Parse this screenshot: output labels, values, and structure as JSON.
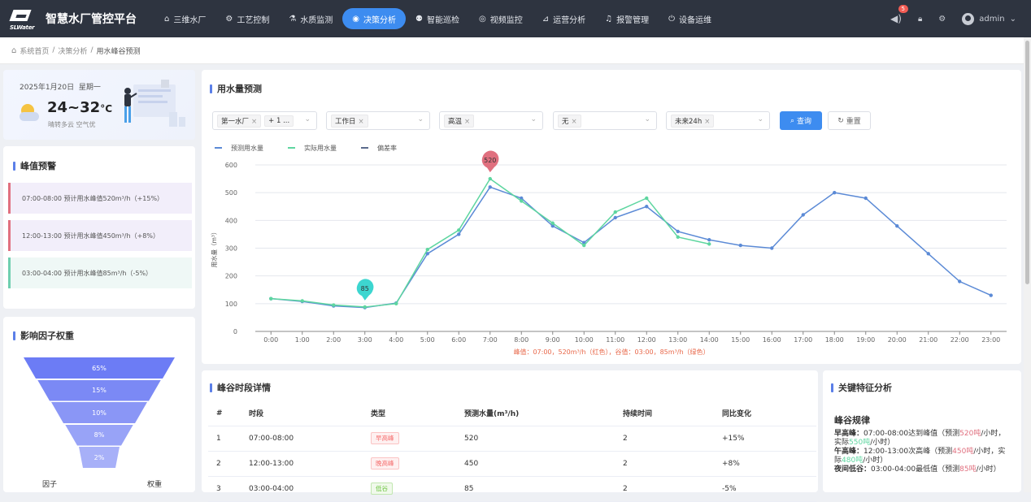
{
  "app": {
    "logo_text": "SLWater",
    "title": "智慧水厂管控平台"
  },
  "nav": [
    {
      "icon": "⌂",
      "label": "三维水厂",
      "active": false
    },
    {
      "icon": "⚙",
      "label": "工艺控制",
      "active": false
    },
    {
      "icon": "⚗",
      "label": "水质监测",
      "active": false
    },
    {
      "icon": "◉",
      "label": "决策分析",
      "active": true
    },
    {
      "icon": "⚉",
      "label": "智能巡检",
      "active": false
    },
    {
      "icon": "◎",
      "label": "视频监控",
      "active": false
    },
    {
      "icon": "⊿",
      "label": "运营分析",
      "active": false
    },
    {
      "icon": "♫",
      "label": "报警管理",
      "active": false
    },
    {
      "icon": "⏻",
      "label": "设备运维",
      "active": false
    }
  ],
  "header_right": {
    "badge_count": "5",
    "user": "admin"
  },
  "breadcrumb": {
    "home": "系统首页",
    "sep1": "/",
    "level2": "决策分析",
    "sep2": "/",
    "current": "用水峰谷预测"
  },
  "weather": {
    "date": "2025年1月20日",
    "weekday": "星期一",
    "temp": "24~32",
    "unit": "°C",
    "desc": "晴转多云  空气优"
  },
  "peak_alert": {
    "title": "峰值预警",
    "items": [
      {
        "text": "07:00-08:00 预计用水峰值520m³/h（+15%）",
        "color": "#e0707f",
        "bg": "#f2eefa"
      },
      {
        "text": "12:00-13:00 预计用水峰值450m³/h（+8%）",
        "color": "#e0707f",
        "bg": "#f2eefa"
      },
      {
        "text": "03:00-04:00 预计用水峰值85m³/h（-5%）",
        "color": "#6fcfb0",
        "bg": "#eff8f6"
      }
    ]
  },
  "factors": {
    "title": "影响因子权重",
    "segments": [
      "65%",
      "15%",
      "10%",
      "8%",
      "2%"
    ],
    "footer_left": "因子",
    "footer_right": "权重"
  },
  "forecast": {
    "title": "用水量预测",
    "filters": {
      "plant": {
        "tags": [
          "第一水厂",
          "+ 1 ..."
        ]
      },
      "daytype": {
        "tags": [
          "工作日"
        ]
      },
      "temp": {
        "tags": [
          "高温"
        ]
      },
      "event": {
        "tags": [
          "无"
        ]
      },
      "range": {
        "tags": [
          "未来24h"
        ]
      }
    },
    "query_label": "查询",
    "reset_label": "重置",
    "caption": "峰值：07:00，520m³/h（红色），谷值：03:00，85m³/h（绿色）"
  },
  "chart_data": {
    "type": "line",
    "ylabel": "用水量（m³）",
    "ylim": [
      0,
      600
    ],
    "yticks": [
      0,
      100,
      200,
      300,
      400,
      500,
      600
    ],
    "x": [
      "0:00",
      "1:00",
      "2:00",
      "3:00",
      "4:00",
      "5:00",
      "6:00",
      "7:00",
      "8:00",
      "9:00",
      "10:00",
      "11:00",
      "12:00",
      "13:00",
      "14:00",
      "15:00",
      "16:00",
      "17:00",
      "18:00",
      "19:00",
      "20:00",
      "21:00",
      "22:00",
      "23:00"
    ],
    "series": [
      {
        "name": "预测用水量",
        "color": "#5b8ad6",
        "values": [
          118,
          108,
          92,
          86,
          102,
          280,
          350,
          520,
          480,
          380,
          320,
          410,
          450,
          360,
          330,
          310,
          300,
          420,
          500,
          480,
          380,
          280,
          180,
          130
        ]
      },
      {
        "name": "实际用水量",
        "color": "#5ed6a0",
        "values": [
          118,
          110,
          95,
          88,
          100,
          295,
          365,
          550,
          470,
          390,
          310,
          430,
          480,
          340,
          315,
          null,
          null,
          null,
          null,
          null,
          null,
          null,
          null,
          null
        ]
      },
      {
        "name": "偏差率",
        "color": "#5b6b8c",
        "values": []
      }
    ],
    "annotations": [
      {
        "label": "520",
        "x": "7:00",
        "y": 550,
        "color": "#e0707f"
      },
      {
        "label": "85",
        "x": "3:00",
        "y": 88,
        "color": "#3dd6d0"
      }
    ],
    "legend": "top-left",
    "grid": true
  },
  "detail_table": {
    "title": "峰谷时段详情",
    "columns": [
      "#",
      "时段",
      "类型",
      "预测水量(m³/h)",
      "持续时间",
      "同比变化"
    ],
    "rows": [
      {
        "no": "1",
        "period": "07:00-08:00",
        "type": "早高峰",
        "kind": "peak",
        "volume": "520",
        "duration": "2",
        "change": "+15%"
      },
      {
        "no": "2",
        "period": "12:00-13:00",
        "type": "晚高峰",
        "kind": "peak",
        "volume": "450",
        "duration": "2",
        "change": "+8%"
      },
      {
        "no": "3",
        "period": "03:00-04:00",
        "type": "低谷",
        "kind": "valley",
        "volume": "85",
        "duration": "2",
        "change": "-5%"
      }
    ]
  },
  "key_features": {
    "title": "关键特征分析",
    "subtitle": "峰谷规律",
    "morning_label": "早高峰：",
    "morning_text_a": "07:00-08:00达到峰值（预测",
    "morning_pred": "520吨",
    "morning_text_b": "/小时，实际",
    "morning_actual": "550吨",
    "morning_text_c": "/小时）",
    "noon_label": "午高峰：",
    "noon_text_a": "12:00-13:00次高峰（预测",
    "noon_pred": "450吨",
    "noon_text_b": "/小时，实际",
    "noon_actual": "480吨",
    "noon_text_c": "/小时）",
    "night_label": "夜间低谷：",
    "night_text_a": "03:00-04:00最低值（预测",
    "night_pred": "85吨",
    "night_text_b": "/小时）"
  }
}
